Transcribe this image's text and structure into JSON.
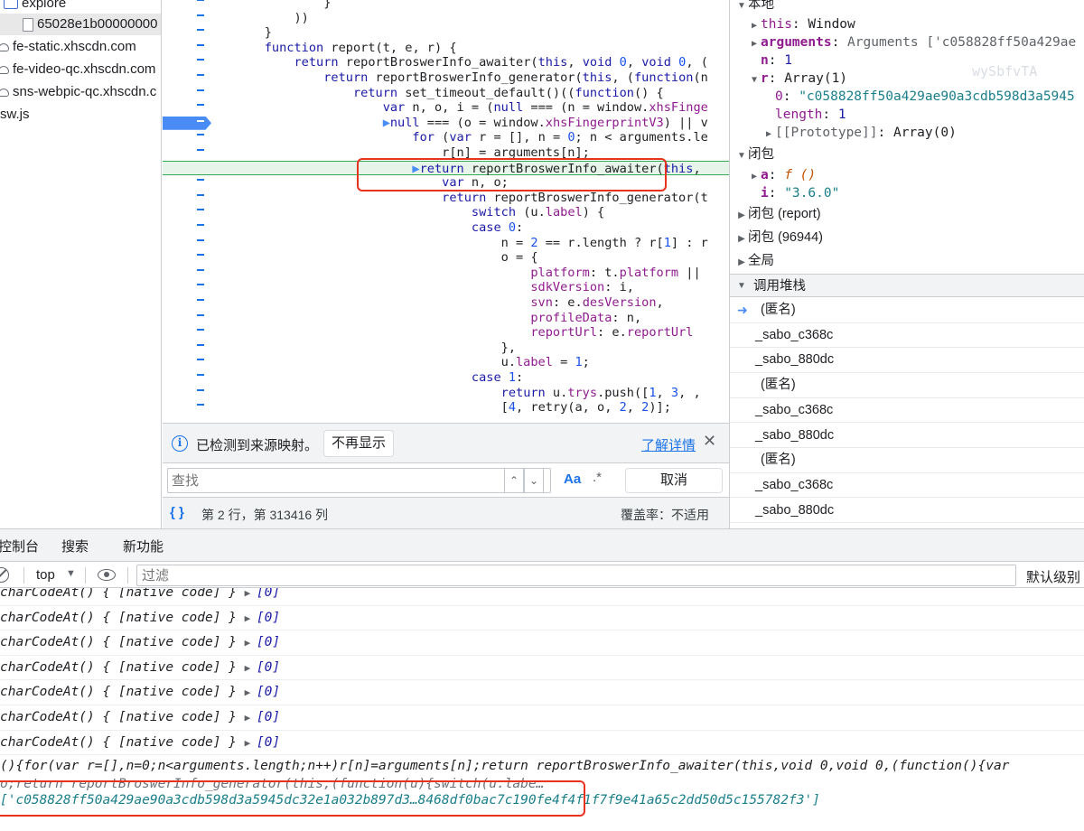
{
  "filetree": {
    "items": [
      {
        "label": "explore",
        "icon": "folder-icon"
      },
      {
        "label": "65028e1b00000000",
        "icon": "file-icon"
      },
      {
        "label": "fe-static.xhscdn.com",
        "icon": "cloud-icon"
      },
      {
        "label": "fe-video-qc.xhscdn.com",
        "icon": "cloud-icon"
      },
      {
        "label": "sns-webpic-qc.xhscdn.c",
        "icon": "cloud-icon"
      },
      {
        "label": "sw.js",
        "icon": ""
      }
    ]
  },
  "editor": {
    "lines": [
      "            }",
      "        ))",
      "    }",
      "    function report(t, e, r) {",
      "        return reportBroswerInfo_awaiter(this, void 0, void 0, (",
      "            return reportBroswerInfo_generator(this, (function(n",
      "                return set_timeout_default()((function() {",
      "                    var n, o, i = (null === (n = window.xhsFinge",
      "                    null === (o = window.xhsFingerprintV3) || v",
      "                        for (var r = [], n = 0; n < arguments.le",
      "                            r[n] = arguments[n];",
      "                        return reportBroswerInfo_awaiter(this,",
      "                            var n, o;",
      "                            return reportBroswerInfo_generator(t",
      "                                switch (u.label) {",
      "                                case 0:",
      "                                    n = 2 == r.length ? r[1] : r",
      "                                    o = {",
      "                                        platform: t.platform ||",
      "                                        sdkVersion: i,",
      "                                        svn: e.desVersion,",
      "                                        profileData: n,",
      "                                        reportUrl: e.reportUrl",
      "                                    },",
      "                                    u.label = 1;",
      "                                case 1:",
      "                                    return u.trys.push([1, 3, ,",
      "                                    [4, retry(a, o, 2, 2)];"
    ],
    "gutter_mark": "–"
  },
  "infobar": {
    "text": "已检测到来源映射。",
    "dont_show": "不再显示",
    "learn_more": "了解详情",
    "close": "✕"
  },
  "search": {
    "placeholder": "查找",
    "match_case": "Aa",
    "regex": ".*",
    "cancel": "取消"
  },
  "status": {
    "position": "第 2 行，第 313416 列",
    "coverage": "覆盖率：不适用"
  },
  "scope": {
    "local_label": "本地",
    "this_key": "this",
    "this_val": "Window",
    "arguments_key": "arguments",
    "arguments_val": "Arguments ['c058828ff50a429ae",
    "n_key": "n",
    "n_val": "1",
    "r_key": "r",
    "r_val": "Array(1)",
    "r0_key": "0",
    "r0_val": "\"c058828ff50a429ae90a3cdb598d3a5945",
    "length_key": "length",
    "length_val": "1",
    "proto_key": "[[Prototype]]",
    "proto_val": "Array(0)",
    "closure_label": "闭包",
    "a_key": "a",
    "a_val": "f ()",
    "i_key": "i",
    "i_val": "\"3.6.0\"",
    "closure_report": "闭包 (report)",
    "closure_96944": "闭包 (96944)",
    "global_label": "全局"
  },
  "callstack": {
    "title": "调用堆栈",
    "frames": [
      "(匿名)",
      "_sabo_c368c",
      "_sabo_880dc",
      "(匿名)",
      "_sabo_c368c",
      "_sabo_880dc",
      "(匿名)",
      "_sabo_c368c",
      "_sabo_880dc"
    ]
  },
  "watermark": "wySbfvTA",
  "console": {
    "tabs": [
      "控制台",
      "搜索",
      "新功能"
    ],
    "context": "top",
    "filter_placeholder": "过滤",
    "levels": "默认级别",
    "log_text": "charCodeAt() { [native code] } ",
    "log_value": "[0]",
    "log_count": 7,
    "fn_line1": "(){for(var r=[],n=0;n<arguments.length;n++)r[n]=arguments[n];return reportBroswerInfo_awaiter(this,void 0,void 0,(function(){var",
    "fn_line2": "o;return reportBroswerInfo_generator(this,(function(u){switch(u.labe…",
    "result": "['c058828ff50a429ae90a3cdb598d3a5945dc32e1a032b897d3…8468df0bac7c190fe4f4f1f7f9e41a65c2dd50d5c155782f3']"
  },
  "colors": {
    "accent": "#1a73e8",
    "breakpoint": "#4a8cf6",
    "highlight_box": "#e8321e",
    "current_line": "#e6f4ea"
  }
}
